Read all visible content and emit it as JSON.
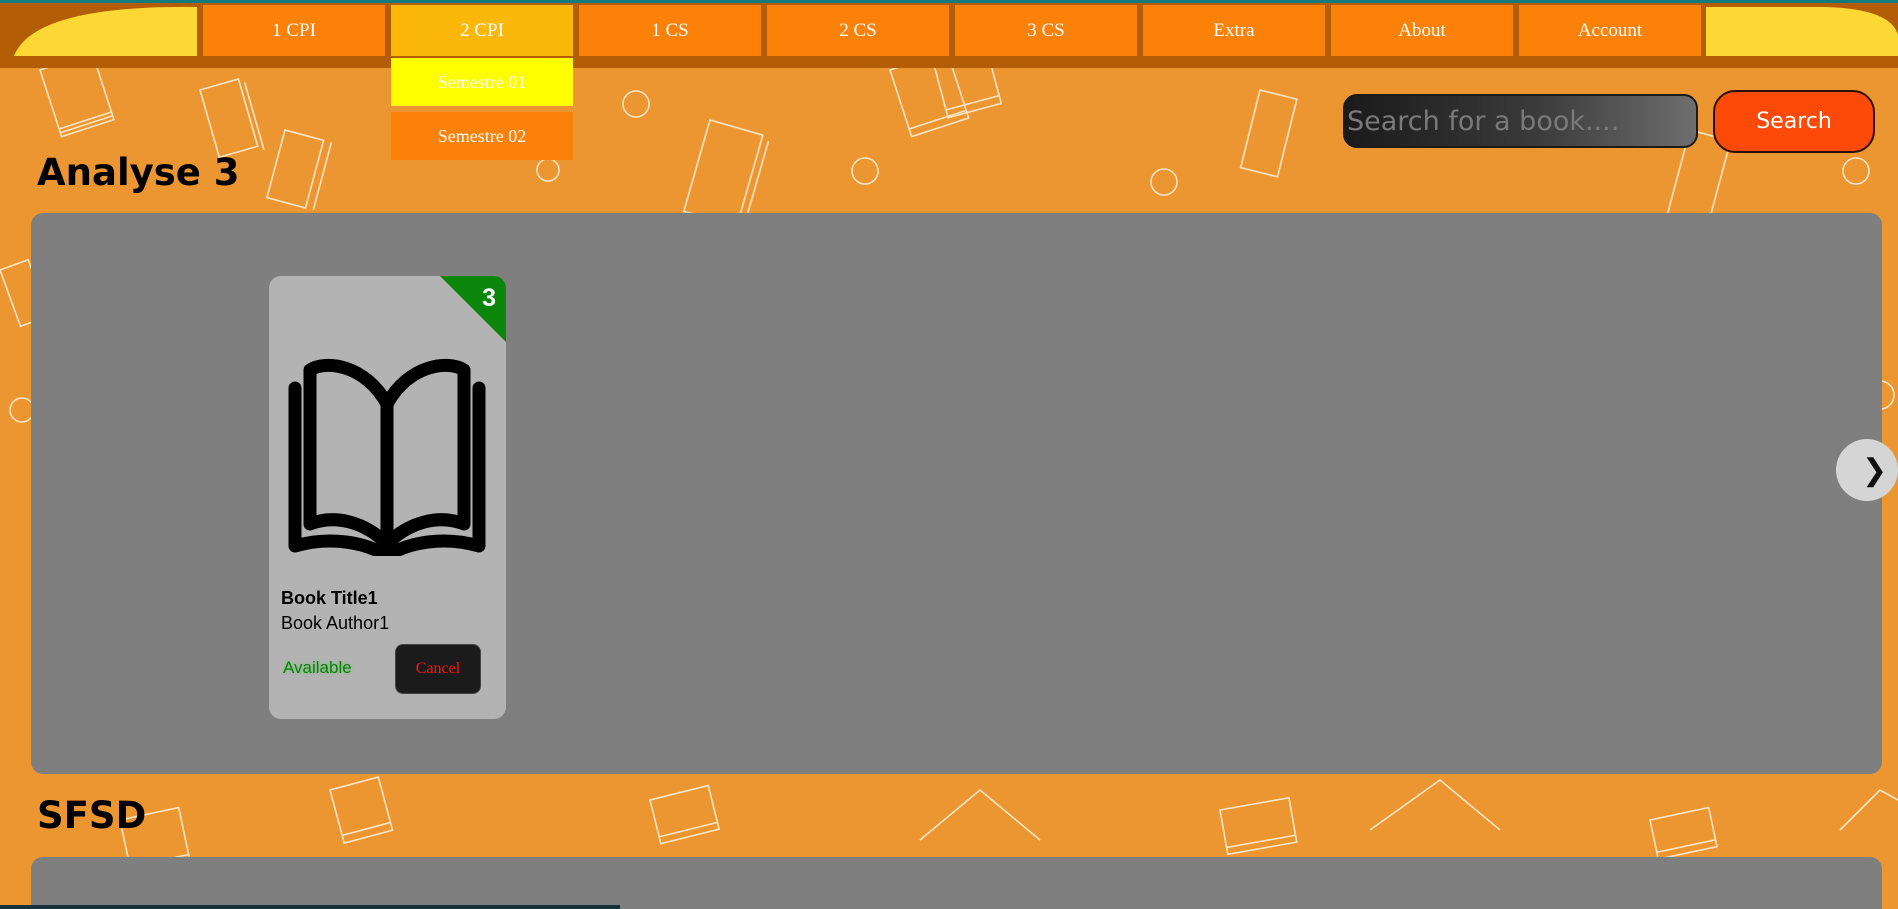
{
  "colors": {
    "nav_bar": "#b35e07",
    "nav_item": "#fb8108",
    "nav_active": "#fbb80a",
    "dropdown_highlight": "#fffe00",
    "page_background": "#ec9632",
    "search_button": "#fd4a09",
    "panel": "#7f7f7f",
    "card": "#b3b3b3",
    "stock_ribbon": "#0b860b",
    "status_available": "#117a11",
    "cancel_text": "#ff1111"
  },
  "nav": {
    "items": [
      {
        "label": "1 CPI"
      },
      {
        "label": "2 CPI"
      },
      {
        "label": "1 CS"
      },
      {
        "label": "2 CS"
      },
      {
        "label": "3 CS"
      },
      {
        "label": "Extra"
      },
      {
        "label": "About"
      },
      {
        "label": "Account"
      }
    ],
    "dropdown": [
      {
        "label": "Semestre 01"
      },
      {
        "label": "Semestre 02"
      }
    ]
  },
  "search": {
    "placeholder": "Search for a book....",
    "button_label": "Search"
  },
  "sections": [
    {
      "title": "Analyse 3",
      "books": [
        {
          "title": "Book Title1",
          "author": "Book Author1",
          "status": "Available",
          "count": "3",
          "action_label": "Cancel",
          "icon": "open-book-icon"
        }
      ],
      "next_icon": "chevron-right-icon"
    },
    {
      "title": "SFSD"
    }
  ]
}
